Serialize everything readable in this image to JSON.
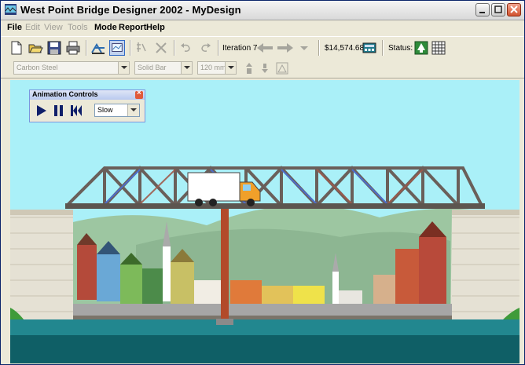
{
  "window": {
    "title": "West Point Bridge Designer 2002 - MyDesign"
  },
  "menu": {
    "items": [
      {
        "label": "File",
        "enabled": true
      },
      {
        "label": "Edit",
        "enabled": false
      },
      {
        "label": "View",
        "enabled": false
      },
      {
        "label": "Tools",
        "enabled": false
      },
      {
        "label": "Mode",
        "enabled": true
      },
      {
        "label": "Report",
        "enabled": true
      },
      {
        "label": "Help",
        "enabled": true
      }
    ]
  },
  "toolbar": {
    "iteration_label": "Iteration 7",
    "cost": "$14,574.68",
    "status_label": "Status:",
    "icons": [
      "new-icon",
      "open-icon",
      "save-icon",
      "print-icon",
      "draw-joints-icon",
      "animate-icon",
      "select-icon",
      "delete-icon",
      "undo-icon",
      "redo-icon",
      "back-icon",
      "forward-icon",
      "dropdown-icon",
      "calculator-icon",
      "status-ok-icon",
      "grid-icon"
    ]
  },
  "member_toolbar": {
    "material": "Carbon Steel",
    "section": "Solid Bar",
    "size": "120 mm"
  },
  "animation_controls": {
    "title": "Animation Controls",
    "speed": "Slow"
  },
  "colors": {
    "sky": "#aaf0f8",
    "water": "#22878f",
    "truss_steel": "#6a5f5a",
    "pier": "#b24a2a",
    "status_ok": "#2e8b3a"
  }
}
